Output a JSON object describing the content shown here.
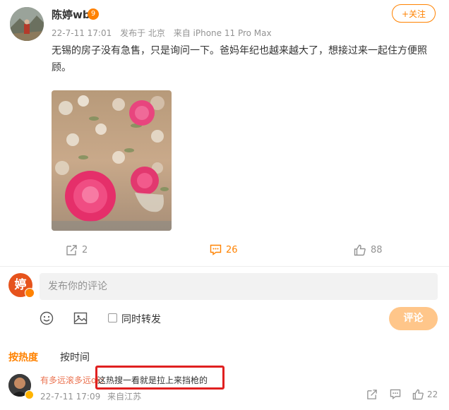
{
  "post": {
    "username": "陈婷wb",
    "vip_badge": "9",
    "follow_label": "+关注",
    "time": "22-7-11 17:01",
    "location": "发布于 北京",
    "source": "来自 iPhone 11 Pro Max",
    "text": "无锡的房子没有急售，只是询问一下。爸妈年纪也越来越大了，想接过来一起住方便照顾。"
  },
  "actions": {
    "repost_count": "2",
    "comment_count": "26",
    "like_count": "88"
  },
  "composer": {
    "avatar_text": "婷",
    "placeholder": "发布你的评论",
    "repost_label": "同时转发",
    "submit_label": "评论"
  },
  "sort": {
    "hot": "按热度",
    "time": "按时间"
  },
  "comment": {
    "username": "有多远滚多远ok:",
    "text": "这热搜一看就是拉上来挡枪的",
    "time": "22-7-11 17:09",
    "source": "来自江苏",
    "like_count": "22"
  },
  "colors": {
    "accent": "#ff8200",
    "highlight": "#e02020"
  }
}
